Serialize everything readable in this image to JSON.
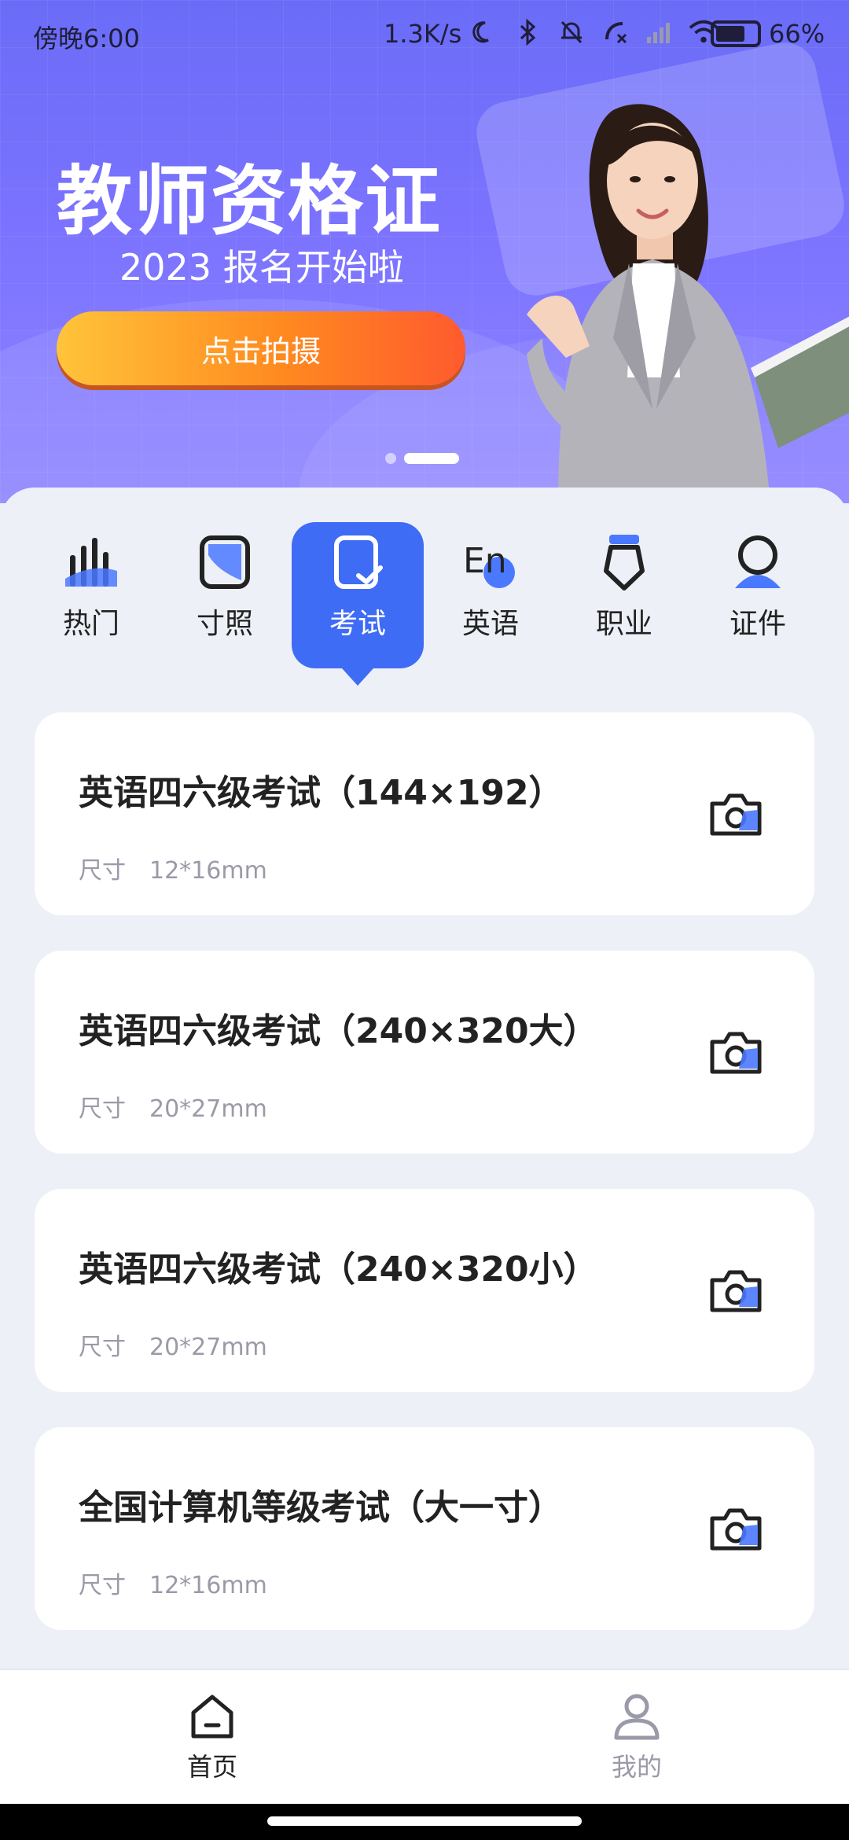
{
  "status_bar": {
    "time": "傍晚6:00",
    "network_speed": "1.3K/s",
    "battery_percent": "66%"
  },
  "banner": {
    "title": "教师资格证",
    "subtitle": "2023 报名开始啦",
    "button_label": "点击拍摄",
    "page_indicator": {
      "count": 2,
      "active_index": 1
    }
  },
  "categories": [
    {
      "label": "热门",
      "icon": "bar-chart-icon"
    },
    {
      "label": "寸照",
      "icon": "photo-frame-icon"
    },
    {
      "label": "考试",
      "icon": "exam-check-icon",
      "active": true
    },
    {
      "label": "英语",
      "icon": "english-en-icon"
    },
    {
      "label": "职业",
      "icon": "badge-icon"
    },
    {
      "label": "证件",
      "icon": "id-person-icon"
    }
  ],
  "list": {
    "size_label": "尺寸",
    "items": [
      {
        "title": "英语四六级考试（144×192）",
        "size": "12*16mm"
      },
      {
        "title": "英语四六级考试（240×320大）",
        "size": "20*27mm"
      },
      {
        "title": "英语四六级考试（240×320小）",
        "size": "20*27mm"
      },
      {
        "title": "全国计算机等级考试（大一寸）",
        "size": "12*16mm"
      }
    ]
  },
  "bottom_nav": {
    "home_label": "首页",
    "mine_label": "我的"
  },
  "colors": {
    "accent": "#3f6cf5",
    "banner_purple": "#7b73ff",
    "button_orange": "#ff7a24"
  }
}
